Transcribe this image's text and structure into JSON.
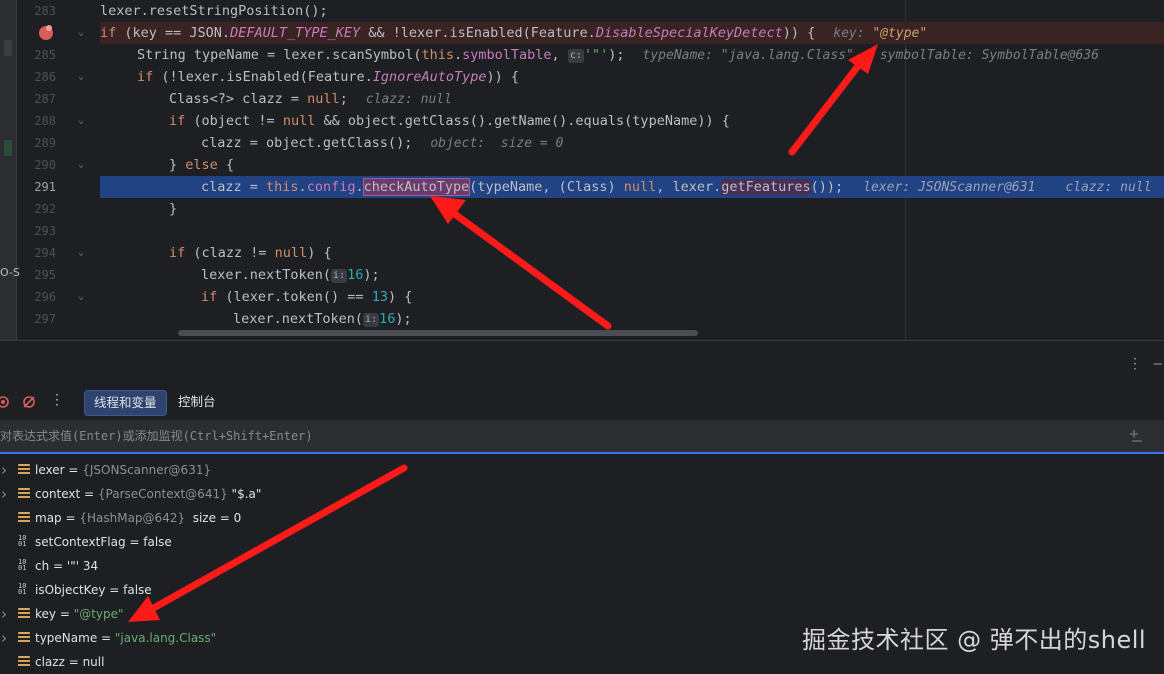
{
  "editor": {
    "gutter": [
      {
        "num": "283",
        "fold": false,
        "bp": false
      },
      {
        "num": "",
        "fold": true,
        "bp": true
      },
      {
        "num": "285",
        "fold": false,
        "bp": false
      },
      {
        "num": "286",
        "fold": true,
        "bp": false
      },
      {
        "num": "287",
        "fold": false,
        "bp": false
      },
      {
        "num": "288",
        "fold": true,
        "bp": false
      },
      {
        "num": "289",
        "fold": false,
        "bp": false
      },
      {
        "num": "290",
        "fold": true,
        "bp": false
      },
      {
        "num": "291",
        "fold": false,
        "bp": false
      },
      {
        "num": "292",
        "fold": false,
        "bp": false
      },
      {
        "num": "293",
        "fold": false,
        "bp": false
      },
      {
        "num": "294",
        "fold": true,
        "bp": false
      },
      {
        "num": "295",
        "fold": false,
        "bp": false
      },
      {
        "num": "296",
        "fold": true,
        "bp": false
      },
      {
        "num": "297",
        "fold": false,
        "bp": false
      }
    ],
    "lines": {
      "l283": {
        "a": "lexer.resetStringPosition();"
      },
      "l284": {
        "a": "if",
        "b": " (key == JSON.",
        "c": "DEFAULT_TYPE_KEY",
        "d": " && !lexer.isEnabled(Feature.",
        "e": "DisableSpecialKeyDetect",
        "f": ")) {",
        "hint_label": "key: ",
        "hint_value": "\"@type\""
      },
      "l285": {
        "a": "String typeName = lexer.scanSymbol(",
        "b": "this",
        "c": ".",
        "d": "symbolTable",
        "e": ", ",
        "badge": "c:",
        "f": "'\"'",
        "g": ");",
        "hint1": "typeName: \"java.lang.Class\"",
        "hint2": "symbolTable: SymbolTable@636"
      },
      "l286": {
        "a": "if",
        "b": " (!lexer.isEnabled(Feature.",
        "c": "IgnoreAutoType",
        "d": ")) {"
      },
      "l287": {
        "a": "Class<?> clazz = ",
        "b": "null",
        "c": ";",
        "hint": "clazz: null"
      },
      "l288": {
        "a": "if",
        "b": " (object != ",
        "c": "null",
        "d": " && object.getClass().getName().equals(typeName)) {"
      },
      "l289": {
        "a": "clazz = object.getClass();",
        "hint": "object:  size = 0"
      },
      "l290": {
        "a": "} ",
        "b": "else",
        "c": " {"
      },
      "l291": {
        "a": "clazz = ",
        "b": "this",
        "c": ".",
        "d": "config",
        "e": ".",
        "f": "checkAutoType",
        "g": "(typeName, (Class) ",
        "h": "null",
        "i": ", lexer.",
        "j": "getFeatures",
        "k": "());",
        "hint1": "lexer: JSONScanner@631",
        "hint2": "clazz: null"
      },
      "l292": {
        "a": "}"
      },
      "l294": {
        "a": "if",
        "b": " (clazz != ",
        "c": "null",
        "d": ") {"
      },
      "l295": {
        "a": "lexer.nextToken(",
        "badge": "i:",
        "b": "16",
        "c": ");"
      },
      "l296": {
        "a": "if",
        "b": " (lexer.token() == ",
        "c": "13",
        "d": ") {"
      },
      "l297": {
        "a": "lexer.nextToken(",
        "badge": "i:",
        "b": "16",
        "c": ");"
      }
    }
  },
  "debugger": {
    "tabs": {
      "threads": "线程和变量",
      "console": "控制台"
    },
    "eval_placeholder": "对表达式求值(Enter)或添加监视(Ctrl+Shift+Enter)",
    "icons": {
      "menu": "⋮",
      "close": "—"
    },
    "variables": [
      {
        "icon": "obj",
        "expandable": true,
        "name": "lexer",
        "sep": " = ",
        "ref": "{JSONScanner@631}",
        "value": "",
        "value_is_string": false
      },
      {
        "icon": "obj",
        "expandable": true,
        "name": "context",
        "sep": " = ",
        "ref": "{ParseContext@641} ",
        "value": "\"$.a\"",
        "value_is_string": false
      },
      {
        "icon": "obj",
        "expandable": false,
        "name": "map",
        "sep": " = ",
        "ref": "{HashMap@642} ",
        "value": " size = 0",
        "value_is_string": false
      },
      {
        "icon": "prim",
        "expandable": false,
        "name": "setContextFlag",
        "sep": " = ",
        "ref": "",
        "value": "false",
        "value_is_string": false
      },
      {
        "icon": "prim",
        "expandable": false,
        "name": "ch",
        "sep": " = ",
        "ref": "",
        "value": "'\"' 34",
        "value_is_string": false
      },
      {
        "icon": "prim",
        "expandable": false,
        "name": "isObjectKey",
        "sep": " = ",
        "ref": "",
        "value": "false",
        "value_is_string": false
      },
      {
        "icon": "obj",
        "expandable": true,
        "name": "key",
        "sep": " = ",
        "ref": "",
        "value": "\"@type\"",
        "value_is_string": true
      },
      {
        "icon": "obj",
        "expandable": true,
        "name": "typeName",
        "sep": " = ",
        "ref": "",
        "value": "\"java.lang.Class\"",
        "value_is_string": true
      },
      {
        "icon": "obj",
        "expandable": false,
        "name": "clazz",
        "sep": " = ",
        "ref": "",
        "value": "null",
        "value_is_string": false
      }
    ]
  },
  "left_edge_text": "O-S",
  "watermark": "掘金技术社区 @ 弹不出的shell",
  "colors": {
    "accent": "#3574f0",
    "arrow": "#ff1a1a",
    "highlight": "#6b3b6b",
    "breakpoint": "#db5c5c"
  }
}
